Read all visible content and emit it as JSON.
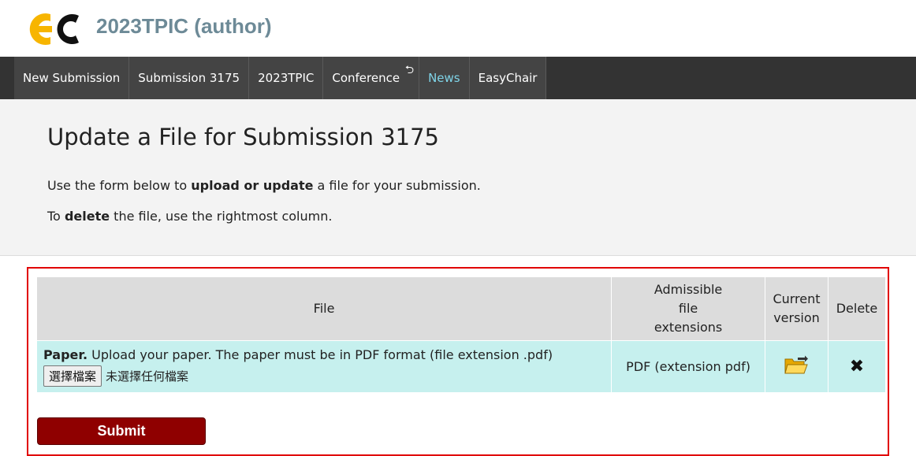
{
  "header": {
    "logo_icon": "easychair-logo-icon",
    "title": "2023TPIC (author)",
    "brand_colors": {
      "logo_yellow": "#f7b500",
      "logo_dark": "#111111",
      "title": "#6d8a97"
    }
  },
  "nav": {
    "items": [
      {
        "label": "New Submission"
      },
      {
        "label": "Submission 3175"
      },
      {
        "label": "2023TPIC"
      },
      {
        "label": "Conference",
        "icon": "return-arrow-icon"
      },
      {
        "label": "News",
        "active": true
      },
      {
        "label": "EasyChair"
      }
    ],
    "active_color": "#7fd4e8"
  },
  "intro": {
    "title": "Update a File for Submission 3175",
    "line1_pre": "Use the form below to ",
    "line1_bold": "upload or update",
    "line1_post": " a file for your submission.",
    "line2_pre": "To ",
    "line2_bold": "delete",
    "line2_post": " the file, use the rightmost column."
  },
  "table": {
    "headers": {
      "file": "File",
      "ext_line1": "Admissible",
      "ext_line2": "file",
      "ext_line3": "extensions",
      "current_line1": "Current",
      "current_line2": "version",
      "delete": "Delete"
    },
    "rows": [
      {
        "name": "Paper.",
        "description": " Upload your paper. The paper must be in PDF format (file extension .pdf)",
        "choose_button": "選擇檔案",
        "no_file": "未選擇任何檔案",
        "extensions": "PDF (extension pdf)",
        "current_icon": "folder-open-icon",
        "delete_icon": "close-icon"
      }
    ]
  },
  "submit": {
    "label": "Submit",
    "color": "#8f0000"
  },
  "highlight_color": "#e10000"
}
